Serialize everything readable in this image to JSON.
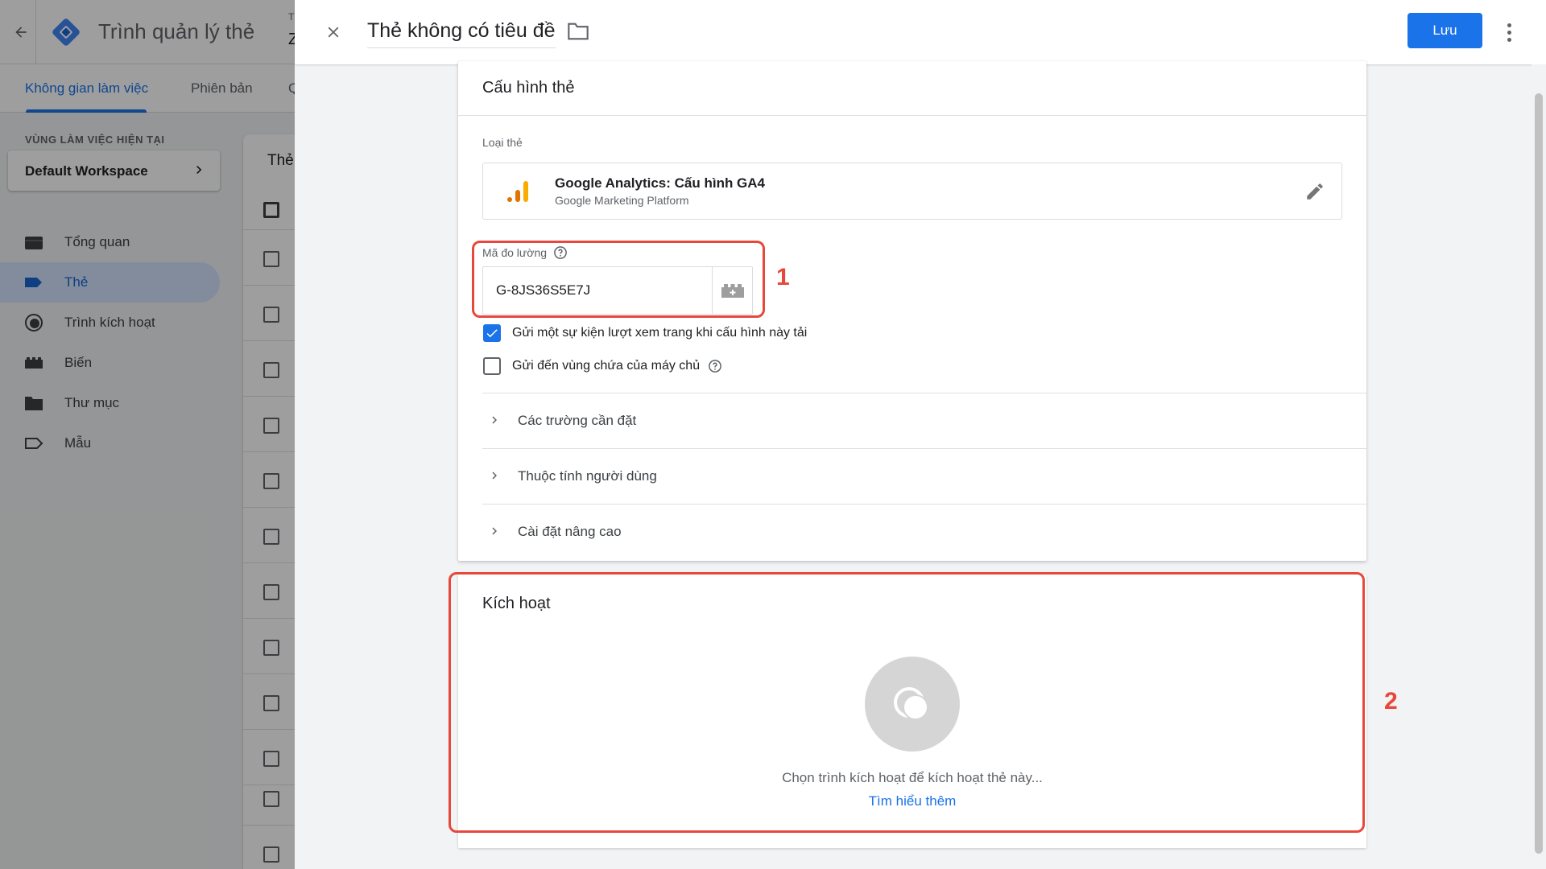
{
  "app": {
    "title": "Trình quản lý thẻ",
    "account_line1": "T",
    "account_line2": "Z",
    "tabs": [
      {
        "label": "Không gian làm việc",
        "active": true
      },
      {
        "label": "Phiên bản",
        "active": false
      },
      {
        "label": "Q",
        "active": false
      }
    ],
    "workspace_label": "VÙNG LÀM VIỆC HIỆN TẠI",
    "workspace_name": "Default Workspace",
    "nav": [
      {
        "label": "Tổng quan",
        "icon": "briefcase-icon"
      },
      {
        "label": "Thẻ",
        "icon": "tag-icon",
        "active": true
      },
      {
        "label": "Trình kích hoạt",
        "icon": "trigger-icon"
      },
      {
        "label": "Biến",
        "icon": "variable-icon"
      },
      {
        "label": "Thư mục",
        "icon": "folder-icon"
      },
      {
        "label": "Mẫu",
        "icon": "template-icon"
      }
    ],
    "list_title": "Thẻ"
  },
  "editor": {
    "title": "Thẻ không có tiêu đề",
    "save_label": "Lưu",
    "config": {
      "title": "Cấu hình thẻ",
      "type_label": "Loại thẻ",
      "tag_type_name": "Google Analytics: Cấu hình GA4",
      "tag_type_sub": "Google Marketing Platform",
      "measurement_label": "Mã đo lường",
      "measurement_value": "G-8JS36S5E7J",
      "checkboxes": [
        {
          "label": "Gửi một sự kiện lượt xem trang khi cấu hình này tải",
          "checked": true
        },
        {
          "label": "Gửi đến vùng chứa của máy chủ",
          "checked": false
        }
      ],
      "sections": [
        {
          "label": "Các trường cần đặt"
        },
        {
          "label": "Thuộc tính người dùng"
        },
        {
          "label": "Cài đặt nâng cao"
        }
      ]
    },
    "trigger": {
      "title": "Kích hoạt",
      "hint": "Chọn trình kích hoạt để kích hoạt thẻ này...",
      "learn_more": "Tìm hiểu thêm"
    }
  },
  "annotations": {
    "label_1": "1",
    "label_2": "2",
    "color": "#e8483b"
  },
  "colors": {
    "accent": "#1a73e8",
    "highlight": "#e8483b"
  }
}
